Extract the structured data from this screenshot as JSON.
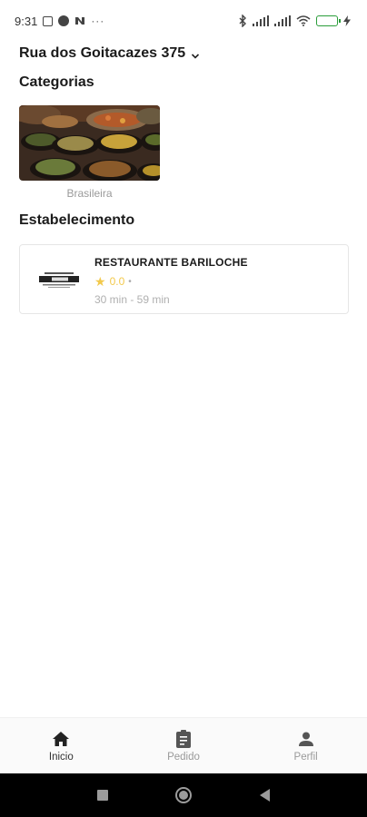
{
  "status_bar": {
    "time": "9:31",
    "dots": "···",
    "icons": [
      "sim-card-icon",
      "data-saver-icon",
      "nfc-icon",
      "bluetooth-icon",
      "signal-icon",
      "signal-icon",
      "wifi-icon",
      "battery-icon",
      "charging-icon"
    ]
  },
  "header": {
    "address": "Rua dos Goitacazes 375"
  },
  "categories": {
    "title": "Categorias",
    "items": [
      {
        "label": "Brasileira",
        "image": "brazilian-food-photo"
      }
    ]
  },
  "establishments": {
    "title": "Estabelecimento",
    "items": [
      {
        "name": "RESTAURANTE BARILOCHE",
        "rating": "0.0",
        "separator": "•",
        "delivery_time": "30 min - 59 min",
        "logo": "bariloche-logo"
      }
    ]
  },
  "bottom_nav": {
    "items": [
      {
        "label": "Inicio",
        "icon": "home-icon",
        "active": true
      },
      {
        "label": "Pedido",
        "icon": "clipboard-icon",
        "active": false
      },
      {
        "label": "Perfil",
        "icon": "person-icon",
        "active": false
      }
    ]
  },
  "colors": {
    "accent_star": "#f2c94c",
    "muted_text": "#9a9a9a",
    "battery": "#2fbf3f"
  }
}
